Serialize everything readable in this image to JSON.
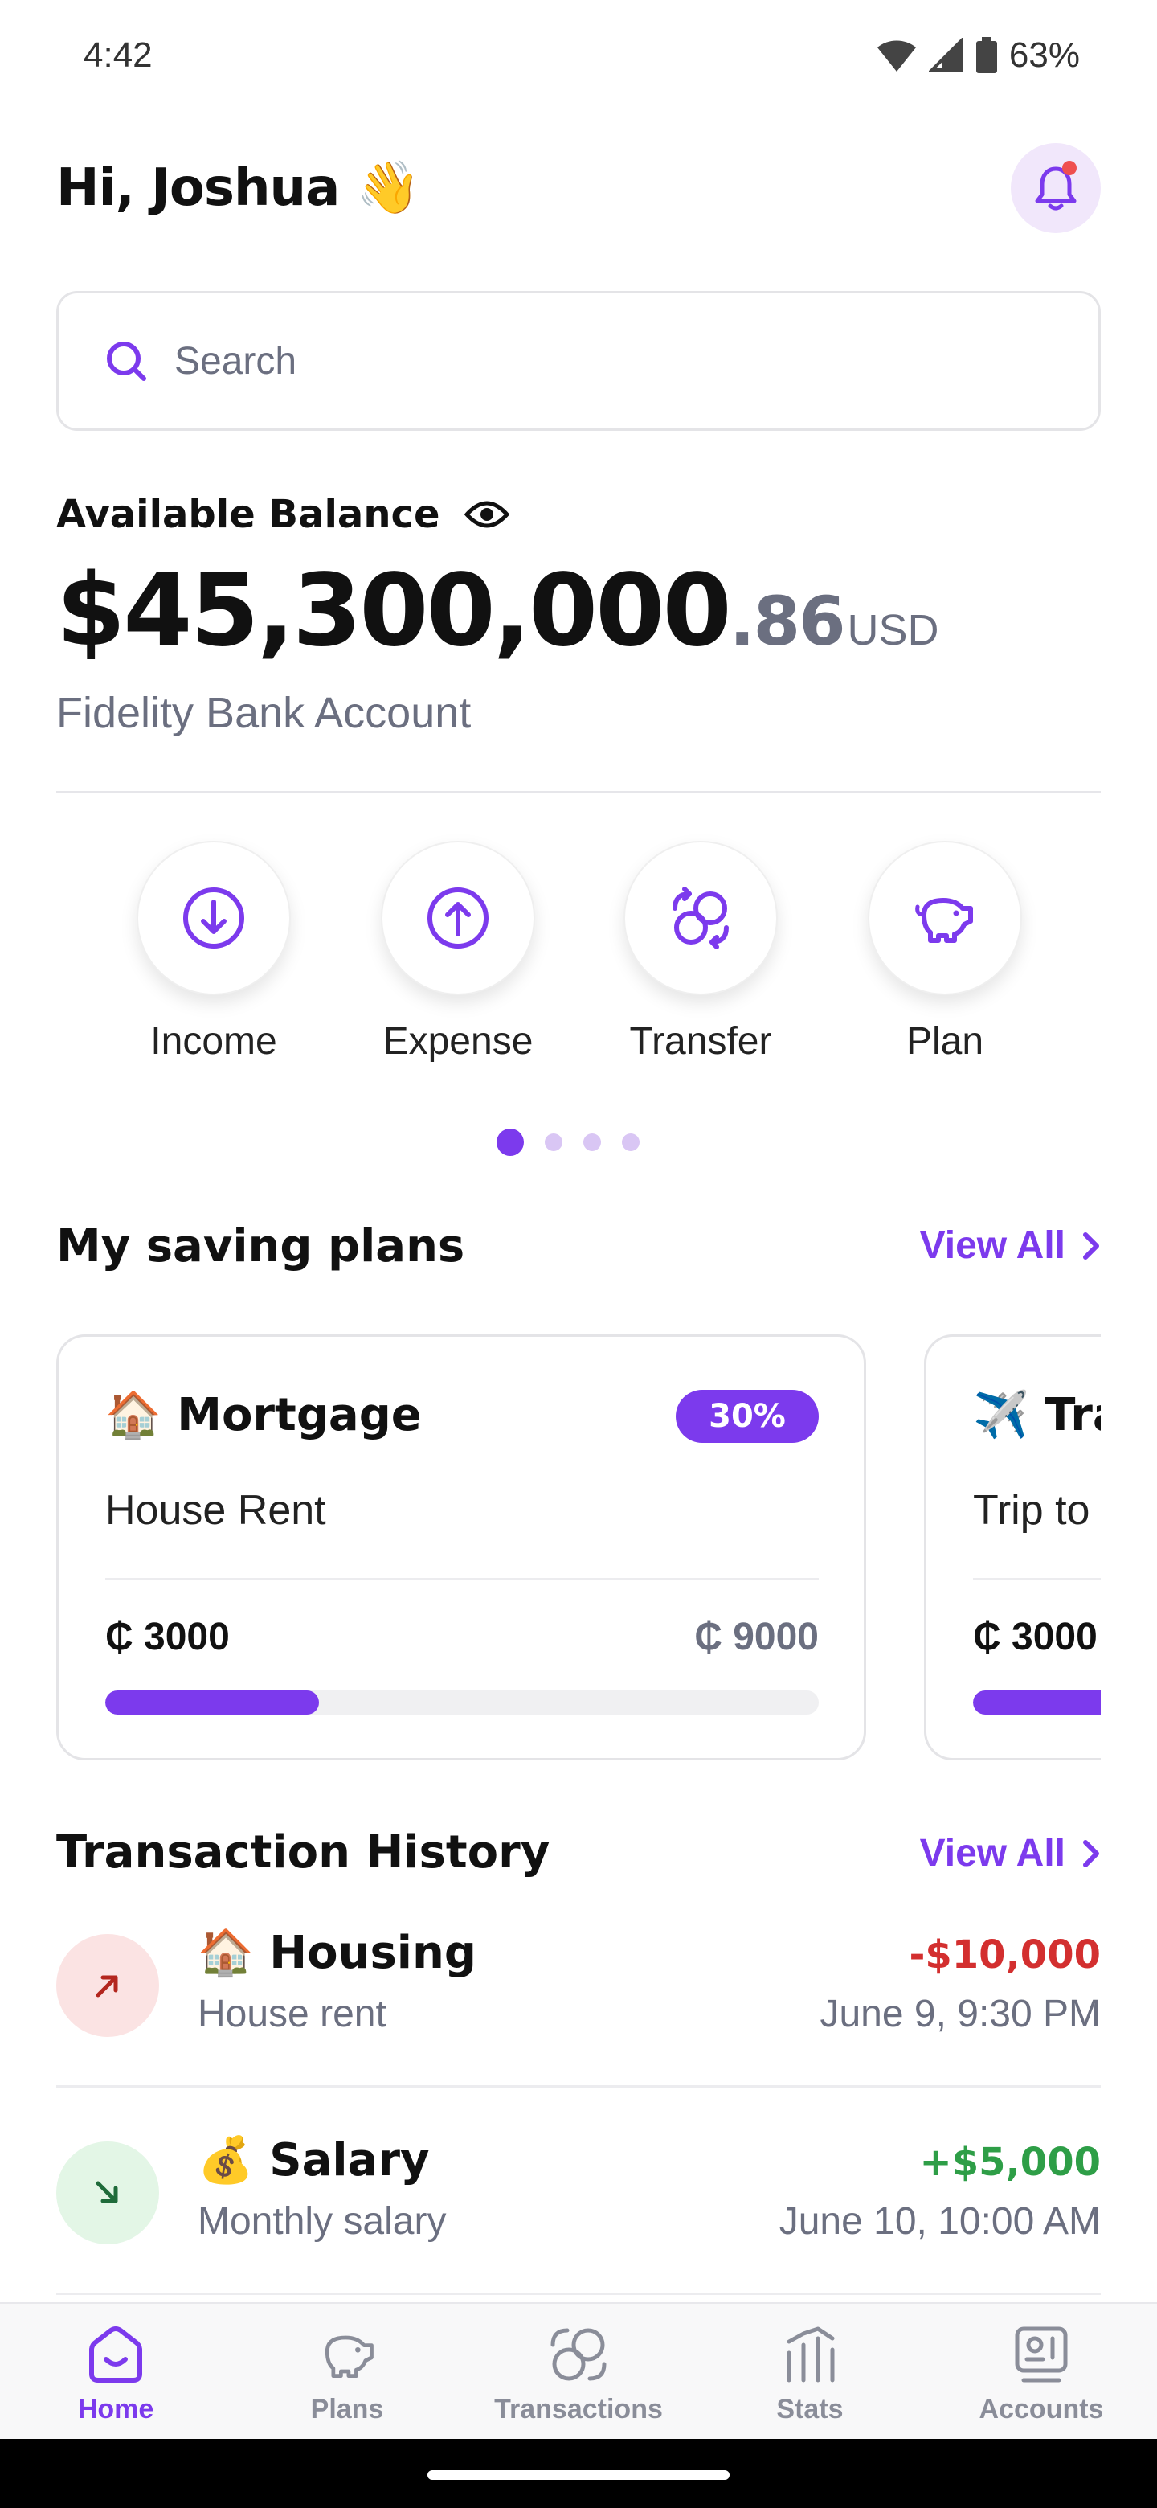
{
  "status_bar": {
    "time": "4:42",
    "battery": "63%"
  },
  "header": {
    "greeting": "Hi, Joshua",
    "wave_emoji": "👋"
  },
  "search": {
    "placeholder": "Search"
  },
  "balance": {
    "label": "Available Balance",
    "amount_main": "$45,300,000",
    "amount_cents": ".86",
    "currency": "USD",
    "account": "Fidelity Bank Account"
  },
  "actions": [
    {
      "label": "Income",
      "icon": "download-icon"
    },
    {
      "label": "Expense",
      "icon": "upload-icon"
    },
    {
      "label": "Transfer",
      "icon": "transfer-icon"
    },
    {
      "label": "Plan",
      "icon": "piggy-bank-icon"
    }
  ],
  "carousel": {
    "pages": 4,
    "active": 0
  },
  "saving_plans": {
    "title": "My saving plans",
    "view_all": "View All",
    "items": [
      {
        "emoji": "🏠",
        "name": "Mortgage",
        "badge": "30%",
        "description": "House Rent",
        "saved": "₵ 3000",
        "target": "₵ 9000",
        "progress": 0.3
      },
      {
        "emoji": "✈️",
        "name": "Tra",
        "badge": "",
        "description": "Trip to",
        "saved": "₵ 3000",
        "target": "",
        "progress": 0.3
      }
    ]
  },
  "transactions": {
    "title": "Transaction History",
    "view_all": "View All",
    "items": [
      {
        "emoji": "🏠",
        "title": "Housing",
        "subtitle": "House rent",
        "amount": "-$10,000",
        "time": "June 9, 9:30 PM",
        "direction": "out"
      },
      {
        "emoji": "💰",
        "title": "Salary",
        "subtitle": "Monthly salary",
        "amount": "+$5,000",
        "time": "June 10, 10:00 AM",
        "direction": "in"
      }
    ]
  },
  "bottom_nav": [
    {
      "label": "Home",
      "icon": "home-icon",
      "active": true
    },
    {
      "label": "Plans",
      "icon": "piggy-bank-icon",
      "active": false
    },
    {
      "label": "Transactions",
      "icon": "transfer-icon",
      "active": false
    },
    {
      "label": "Stats",
      "icon": "stats-icon",
      "active": false
    },
    {
      "label": "Accounts",
      "icon": "accounts-icon",
      "active": false
    }
  ],
  "colors": {
    "accent": "#7c3aed",
    "negative": "#d32f2f",
    "positive": "#2e9e47",
    "muted_text": "#6b6f80"
  }
}
